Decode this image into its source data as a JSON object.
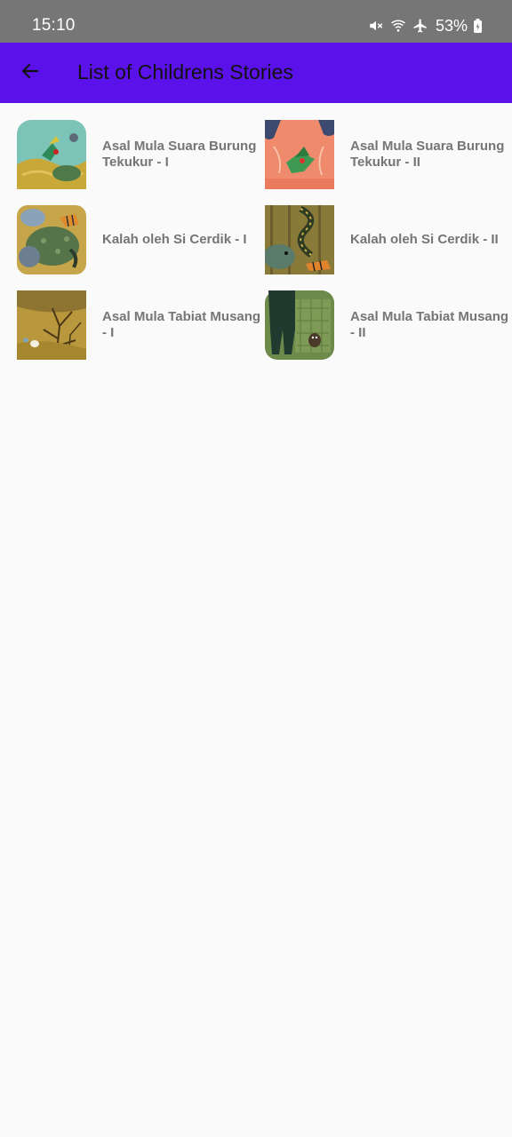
{
  "status_bar": {
    "time": "15:10",
    "battery": "53%",
    "icons": [
      "mute-icon",
      "wifi-icon",
      "airplane-icon",
      "battery-icon"
    ]
  },
  "app_bar": {
    "title": "List of Childrens Stories",
    "back_icon": "arrow-left-icon",
    "color": "#5b12ea"
  },
  "stories": [
    {
      "title": "Asal Mula Suara Burung Tekukur - I"
    },
    {
      "title": "Asal Mula Suara Burung Tekukur - II"
    },
    {
      "title": "Kalah oleh Si Cerdik - I"
    },
    {
      "title": "Kalah oleh Si Cerdik - II"
    },
    {
      "title": "Asal Mula Tabiat Musang - I"
    },
    {
      "title": "Asal Mula Tabiat Musang - II"
    }
  ]
}
